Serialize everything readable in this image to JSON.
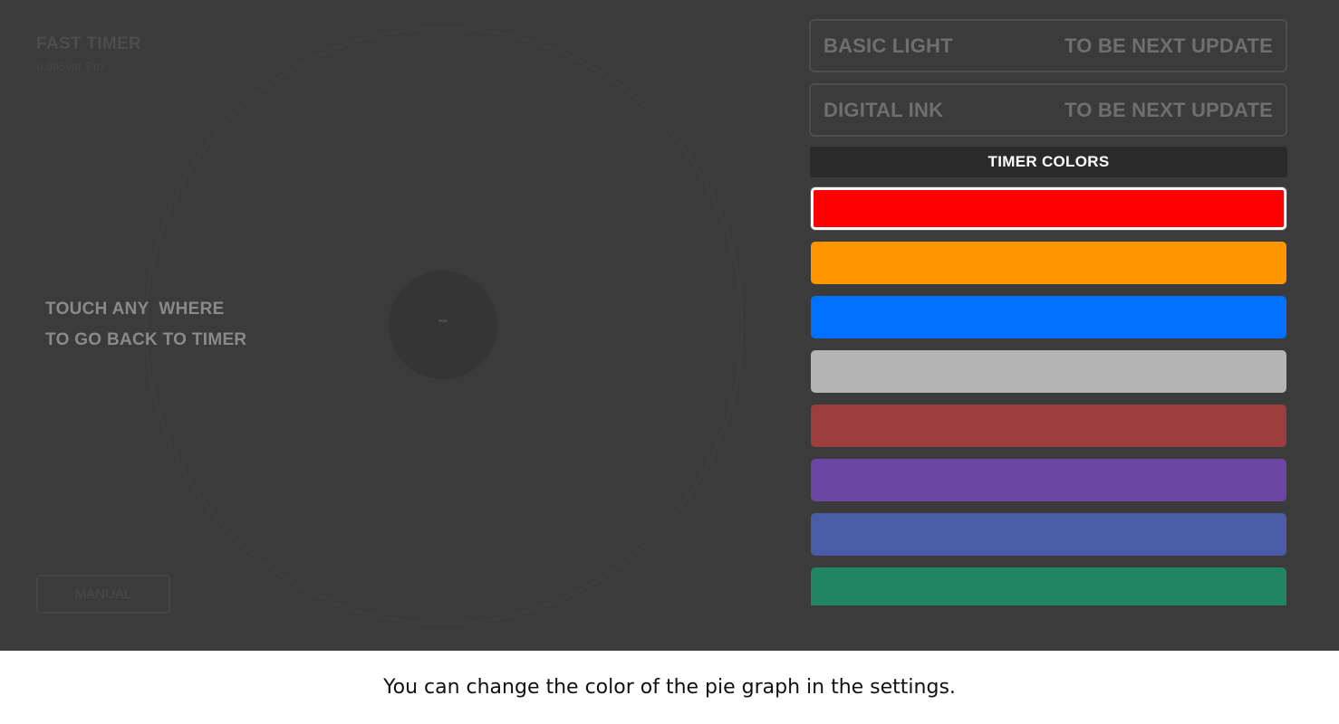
{
  "app": {
    "title": "FAST TIMER",
    "version": "0.995ver Pro"
  },
  "hint": {
    "line1": "TOUCH ANY  WHERE",
    "line2": "TO GO BACK TO TIMER"
  },
  "manual_button": {
    "label": "MANUAL"
  },
  "settings": {
    "theme_rows": [
      {
        "name": "BASIC LIGHT",
        "status": "TO BE NEXT UPDATE"
      },
      {
        "name": "DIGITAL INK",
        "status": "TO BE NEXT UPDATE"
      }
    ],
    "timer_colors": {
      "header": "TIMER COLORS",
      "selected_index": 0,
      "swatches": [
        {
          "name": "red",
          "color": "#ff0000"
        },
        {
          "name": "orange",
          "color": "#ff9500"
        },
        {
          "name": "blue",
          "color": "#0070ff"
        },
        {
          "name": "silver",
          "color": "#b4b4b4"
        },
        {
          "name": "brick",
          "color": "#9c3e3e"
        },
        {
          "name": "purple",
          "color": "#6b47a3"
        },
        {
          "name": "indigo",
          "color": "#4a5ca8"
        },
        {
          "name": "green",
          "color": "#208462"
        }
      ]
    }
  },
  "caption": "You can change the color of the pie graph in the settings."
}
